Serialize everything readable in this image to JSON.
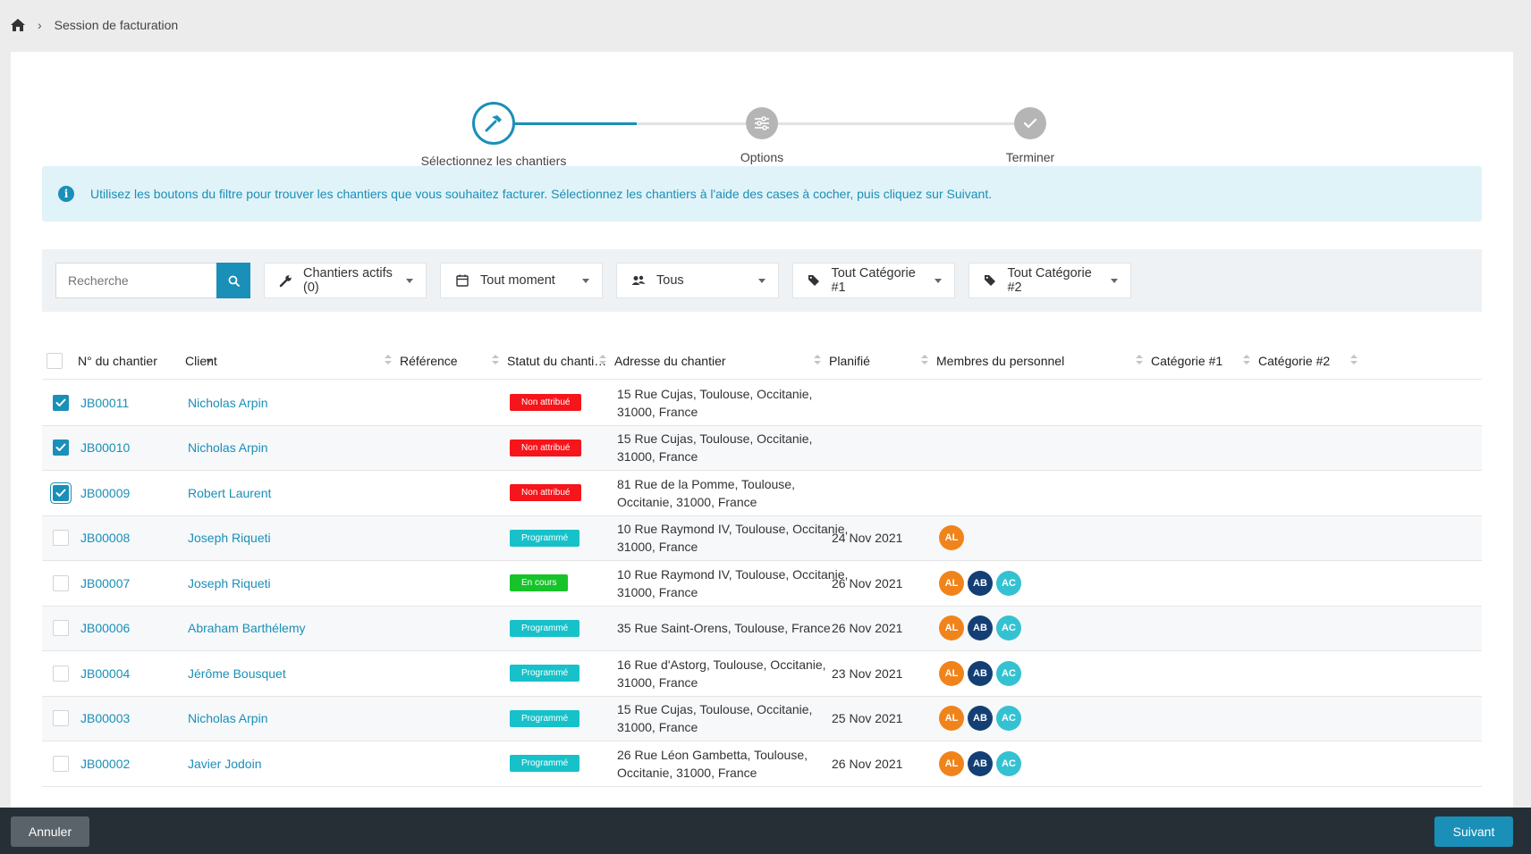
{
  "breadcrumb": {
    "home_icon": "home-icon",
    "separator": "›",
    "current": "Session de facturation"
  },
  "stepper": {
    "steps": [
      {
        "label": "Sélectionnez les chantiers",
        "icon": "hammer-icon",
        "state": "active"
      },
      {
        "label": "Options",
        "icon": "sliders-icon",
        "state": "inactive"
      },
      {
        "label": "Terminer",
        "icon": "check-icon",
        "state": "inactive"
      }
    ]
  },
  "info": {
    "text": "Utilisez les boutons du filtre pour trouver les chantiers que vous souhaitez facturer. Sélectionnez les chantiers à l'aide des cases à cocher, puis cliquez sur Suivant."
  },
  "filters": {
    "search_placeholder": "Recherche",
    "search_value": "",
    "chantiers": "Chantiers actifs (0)",
    "period": "Tout moment",
    "members": "Tous",
    "category1": "Tout Catégorie #1",
    "category2": "Tout Catégorie #2"
  },
  "table": {
    "columns": {
      "num": "N° du chantier",
      "client": "Client",
      "reference": "Référence",
      "status": "Statut du chanti…",
      "address": "Adresse du chantier",
      "planned": "Planifié",
      "members": "Membres du personnel",
      "cat1": "Catégorie #1",
      "cat2": "Catégorie #2"
    },
    "rows": [
      {
        "checked": true,
        "num": "JB00011",
        "client": "Nicholas Arpin",
        "status": "Non attribué",
        "address1": "15 Rue Cujas, Toulouse, Occitanie,",
        "address2": "31000, France",
        "planned": "",
        "members": []
      },
      {
        "checked": true,
        "num": "JB00010",
        "client": "Nicholas Arpin",
        "status": "Non attribué",
        "address1": "15 Rue Cujas, Toulouse, Occitanie,",
        "address2": "31000, France",
        "planned": "",
        "members": []
      },
      {
        "checked": true,
        "num": "JB00009",
        "client": "Robert Laurent",
        "status": "Non attribué",
        "address1": "81 Rue de la Pomme, Toulouse,",
        "address2": "Occitanie, 31000, France",
        "planned": "",
        "members": []
      },
      {
        "checked": false,
        "num": "JB00008",
        "client": "Joseph Riqueti",
        "status": "Programmé",
        "address1": "10 Rue Raymond IV, Toulouse, Occitanie,",
        "address2": "31000, France",
        "planned": "24 Nov 2021",
        "members": [
          "AL"
        ]
      },
      {
        "checked": false,
        "num": "JB00007",
        "client": "Joseph Riqueti",
        "status": "En cours",
        "address1": "10 Rue Raymond IV, Toulouse, Occitanie,",
        "address2": "31000, France",
        "planned": "26 Nov 2021",
        "members": [
          "AL",
          "AB",
          "AC"
        ]
      },
      {
        "checked": false,
        "num": "JB00006",
        "client": "Abraham Barthélemy",
        "status": "Programmé",
        "address1": "35 Rue Saint-Orens, Toulouse, France",
        "address2": "",
        "planned": "26 Nov 2021",
        "members": [
          "AL",
          "AB",
          "AC"
        ]
      },
      {
        "checked": false,
        "num": "JB00004",
        "client": "Jérôme Bousquet",
        "status": "Programmé",
        "address1": "16 Rue d'Astorg, Toulouse, Occitanie,",
        "address2": "31000, France",
        "planned": "23 Nov 2021",
        "members": [
          "AL",
          "AB",
          "AC"
        ]
      },
      {
        "checked": false,
        "num": "JB00003",
        "client": "Nicholas Arpin",
        "status": "Programmé",
        "address1": "15 Rue Cujas, Toulouse, Occitanie,",
        "address2": "31000, France",
        "planned": "25 Nov 2021",
        "members": [
          "AL",
          "AB",
          "AC"
        ]
      },
      {
        "checked": false,
        "num": "JB00002",
        "client": "Javier Jodoin",
        "status": "Programmé",
        "address1": "26 Rue Léon Gambetta, Toulouse,",
        "address2": "Occitanie, 31000, France",
        "planned": "26 Nov 2021",
        "members": [
          "AL",
          "AB",
          "AC"
        ]
      }
    ]
  },
  "status_colors": {
    "Non attribué": "#f5151b",
    "Programmé": "#17c1c9",
    "En cours": "#16c42a"
  },
  "member_colors": {
    "AL": "#f0841b",
    "AB": "#133f75",
    "AC": "#34c2d2"
  },
  "footer": {
    "cancel_label": "Annuler",
    "next_label": "Suivant"
  },
  "colors": {
    "accent": "#1a8fb8",
    "footer_bg": "#262f36"
  }
}
